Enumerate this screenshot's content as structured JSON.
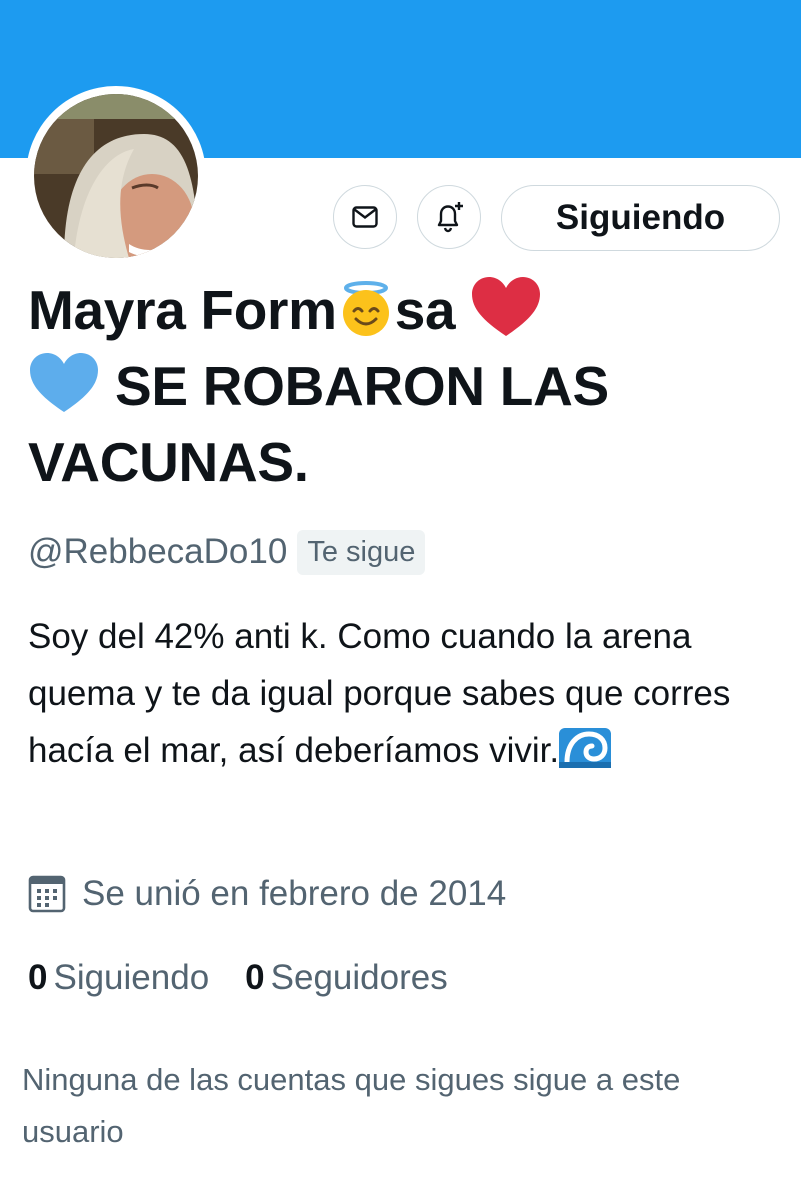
{
  "profile": {
    "name_part1": "Mayra Form",
    "name_part2": "sa",
    "name_part3": "SE ROBARON LAS VACUNAS.",
    "handle": "@RebbecaDo10",
    "follows_you": "Te sigue",
    "bio": "Soy del 42% anti k.  Como cuando la arena quema y te da igual porque sabes que corres hacía el mar, así deberíamos vivir.",
    "joined": "Se unió en febrero de 2014",
    "following_count": "0",
    "following_label": "Siguiendo",
    "followers_count": "0",
    "followers_label": "Seguidores",
    "mutual_note": "Ninguna de las cuentas que sigues sigue a este usuario"
  },
  "actions": {
    "follow_state_label": "Siguiendo"
  },
  "icons": {
    "message": "mail-icon",
    "notify": "bell-plus-icon",
    "joined": "calendar-icon"
  },
  "colors": {
    "banner": "#1d9bf0",
    "text": "#0f1419",
    "secondary": "#536471",
    "border": "#cfd9de"
  }
}
